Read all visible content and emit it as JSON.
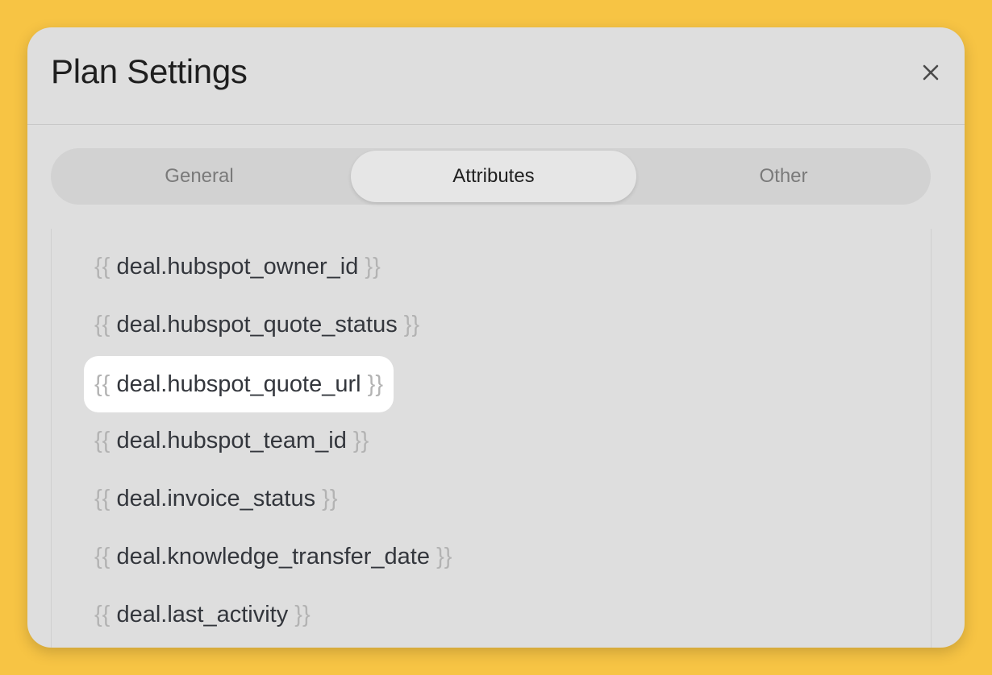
{
  "dialog": {
    "title": "Plan Settings",
    "close_icon": "close-icon"
  },
  "tabs": [
    {
      "label": "General",
      "active": false
    },
    {
      "label": "Attributes",
      "active": true
    },
    {
      "label": "Other",
      "active": false
    }
  ],
  "attributes": {
    "open_brace": "{{",
    "close_brace": "}}",
    "items": [
      {
        "name": "deal.hubspot_owner_id",
        "highlighted": false
      },
      {
        "name": "deal.hubspot_quote_status",
        "highlighted": false
      },
      {
        "name": "deal.hubspot_quote_url",
        "highlighted": true
      },
      {
        "name": "deal.hubspot_team_id",
        "highlighted": false
      },
      {
        "name": "deal.invoice_status",
        "highlighted": false
      },
      {
        "name": "deal.knowledge_transfer_date",
        "highlighted": false
      },
      {
        "name": "deal.last_activity",
        "highlighted": false
      }
    ]
  },
  "colors": {
    "background": "#f7c444",
    "modal": "#dedede",
    "highlight": "#ffffff"
  }
}
